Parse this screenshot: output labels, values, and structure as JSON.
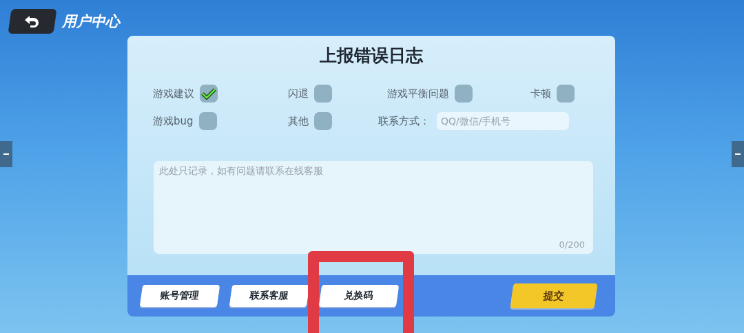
{
  "header": {
    "title": "用户中心"
  },
  "dialog": {
    "title": "上报错误日志",
    "option_rows": [
      [
        {
          "label": "游戏建议",
          "checked": true
        },
        {
          "label": "闪退",
          "checked": false
        },
        {
          "label": "游戏平衡问题",
          "checked": false
        },
        {
          "label": "卡顿",
          "checked": false
        }
      ],
      [
        {
          "label": "游戏bug",
          "checked": false
        },
        {
          "label": "其他",
          "checked": false
        }
      ]
    ],
    "contact": {
      "label": "联系方式：",
      "placeholder": "QQ/微信/手机号"
    },
    "message": {
      "placeholder": "此处只记录，如有问题请联系在线客服",
      "counter": "0/200"
    },
    "buttons": [
      {
        "label": "账号管理",
        "highlighted": false
      },
      {
        "label": "联系客服",
        "highlighted": false
      },
      {
        "label": "兑换码",
        "highlighted": true
      }
    ],
    "submit": "提交"
  }
}
